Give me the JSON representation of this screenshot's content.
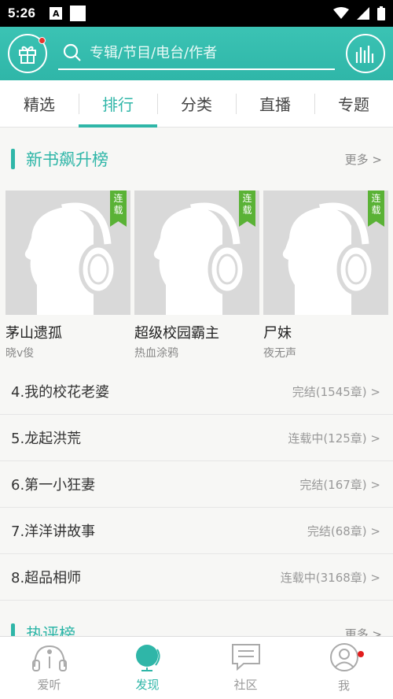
{
  "status_bar": {
    "time": "5:26",
    "icon_letter": "A"
  },
  "header": {
    "search_placeholder": "专辑/节目/电台/作者"
  },
  "tabs": [
    {
      "label": "精选",
      "active": false
    },
    {
      "label": "排行",
      "active": true
    },
    {
      "label": "分类",
      "active": false
    },
    {
      "label": "直播",
      "active": false
    },
    {
      "label": "专题",
      "active": false
    }
  ],
  "section1": {
    "title": "新书飙升榜",
    "more": "更多 >",
    "books": [
      {
        "title": "茅山遗孤",
        "author": "晓v俊",
        "badge": "连载"
      },
      {
        "title": "超级校园霸主",
        "author": "热血涂鸦",
        "badge": "连载"
      },
      {
        "title": "尸妹",
        "author": "夜无声",
        "badge": "连载"
      }
    ],
    "list": [
      {
        "title": "4.我的校花老婆",
        "status": "完结(1545章) >"
      },
      {
        "title": "5.龙起洪荒",
        "status": "连载中(125章) >"
      },
      {
        "title": "6.第一小狂妻",
        "status": "完结(167章) >"
      },
      {
        "title": "7.洋洋讲故事",
        "status": "完结(68章) >"
      },
      {
        "title": "8.超品相师",
        "status": "连载中(3168章) >"
      }
    ]
  },
  "section2": {
    "title": "热评榜",
    "more": "更多 >"
  },
  "bottom_nav": [
    {
      "label": "爱听",
      "icon": "headphones-icon",
      "active": false
    },
    {
      "label": "发现",
      "icon": "globe-icon",
      "active": true
    },
    {
      "label": "社区",
      "icon": "chat-icon",
      "active": false
    },
    {
      "label": "我",
      "icon": "user-icon",
      "active": false
    }
  ],
  "colors": {
    "accent": "#2fb6a8",
    "badge_green": "#5ab236",
    "dot_red": "#e21d1d"
  }
}
